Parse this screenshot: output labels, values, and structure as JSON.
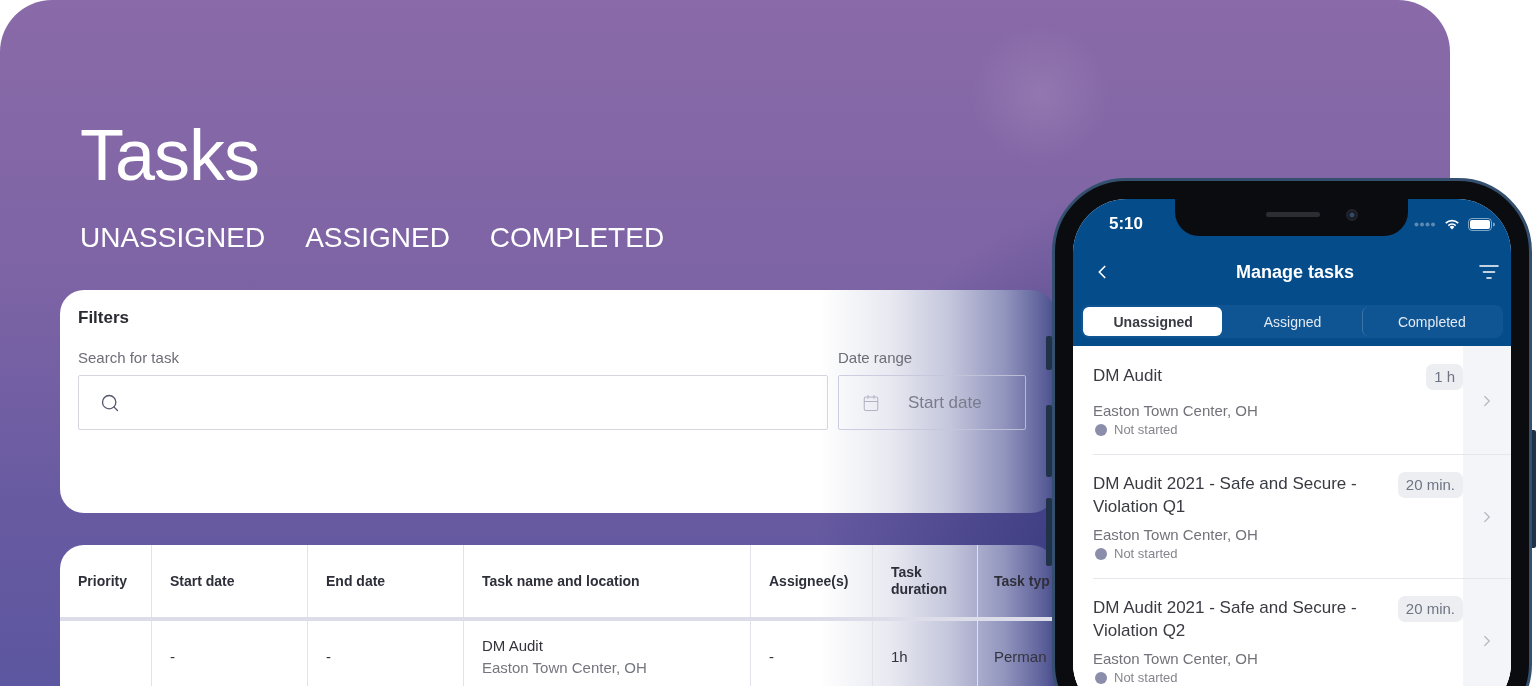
{
  "page": {
    "title": "Tasks",
    "tabs": [
      {
        "label": "UNASSIGNED"
      },
      {
        "label": "ASSIGNED"
      },
      {
        "label": "COMPLETED"
      }
    ]
  },
  "filters": {
    "title": "Filters",
    "search": {
      "label": "Search for task"
    },
    "date_range": {
      "label": "Date range",
      "placeholder": "Start date"
    }
  },
  "table": {
    "columns": [
      "Priority",
      "Start date",
      "End date",
      "Task name and location",
      "Assignee(s)",
      "Task duration",
      "Task typ"
    ],
    "rows": [
      {
        "start_date": "-",
        "end_date": "-",
        "task": {
          "name": "DM Audit",
          "location": "Easton Town Center, OH"
        },
        "assignees": "-",
        "task_duration": "1h",
        "column_7": "Perman"
      }
    ]
  },
  "phone": {
    "status_bar": {
      "time": "5:10"
    },
    "title": "Manage tasks",
    "tabs": [
      {
        "label": "Unassigned",
        "selected": true
      },
      {
        "label": "Assigned",
        "selected": false
      },
      {
        "label": "Completed",
        "selected": false
      }
    ],
    "tasks": [
      {
        "name": "DM Audit",
        "duration": "1 h",
        "location": "Easton Town Center, OH",
        "status": "Not started"
      },
      {
        "name": "DM Audit 2021 - Safe and Secure - Violation Q1",
        "duration": "20 min.",
        "location": "Easton Town Center, OH",
        "status": "Not started"
      },
      {
        "name": "DM Audit 2021 - Safe and Secure - Violation Q2",
        "duration": "20 min.",
        "location": "Easton Town Center, OH",
        "status": "Not started"
      }
    ]
  }
}
